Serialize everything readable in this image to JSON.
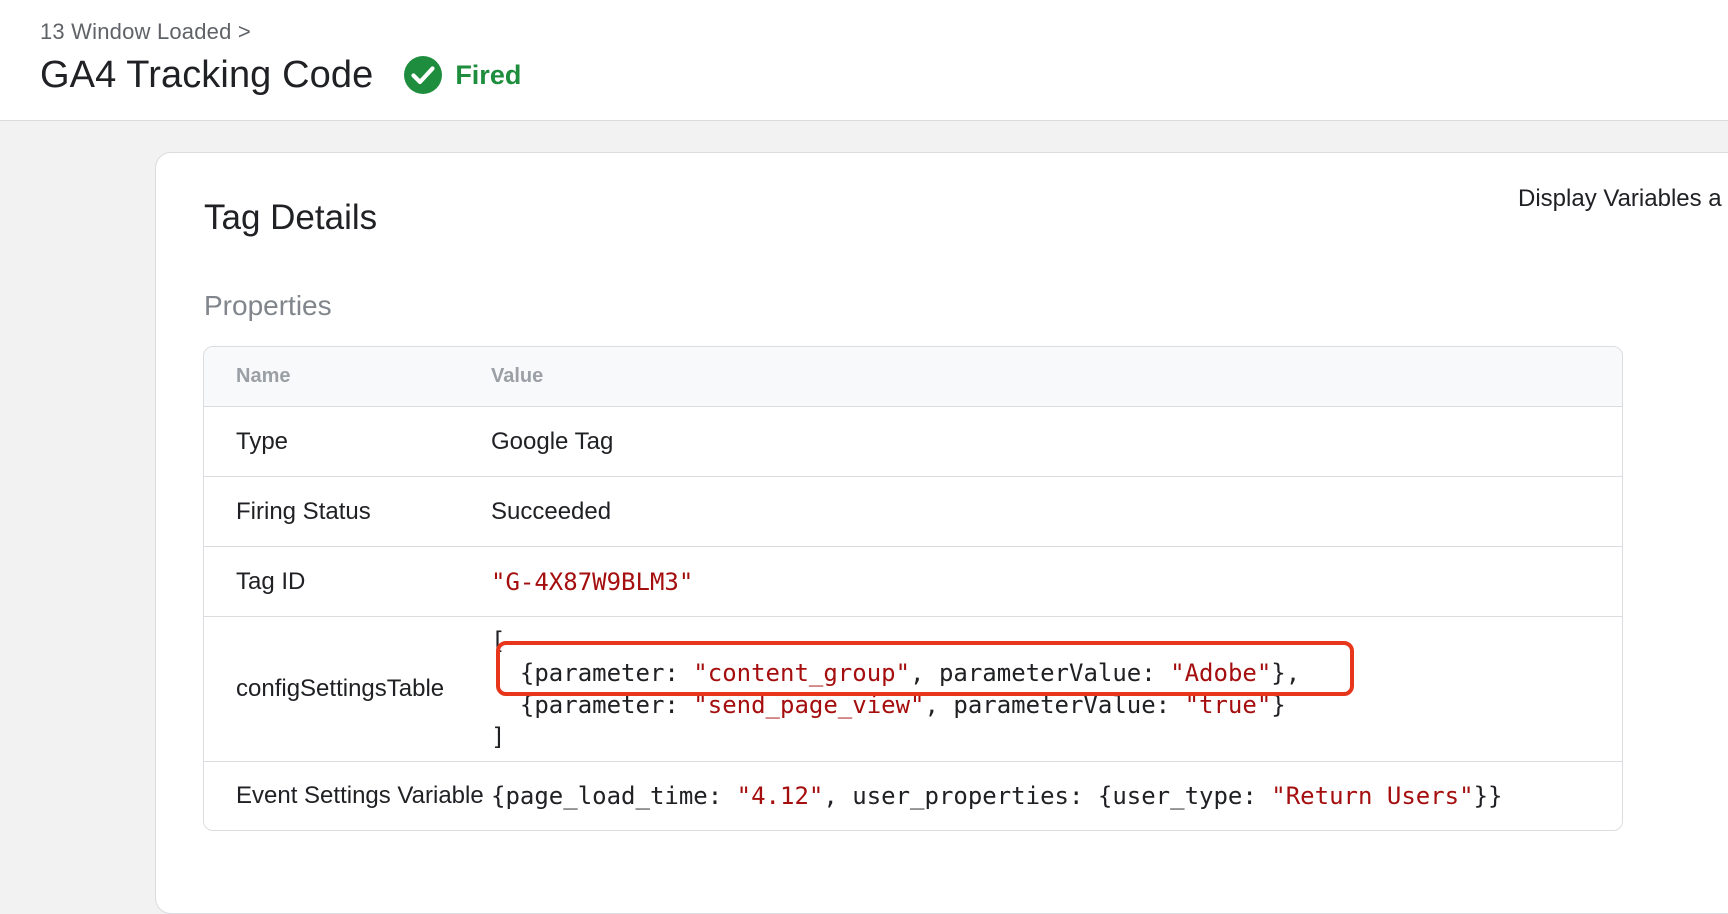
{
  "header": {
    "breadcrumb": "13 Window Loaded >",
    "title": "GA4 Tracking Code",
    "status": "Fired",
    "status_icon": "check-circle-icon",
    "status_color": "#1e8e3e"
  },
  "card": {
    "title": "Tag Details",
    "display_variables_label": "Display Variables a",
    "section_title": "Properties",
    "table": {
      "columns": [
        "Name",
        "Value"
      ],
      "rows": {
        "type": {
          "name": "Type",
          "value": "Google Tag"
        },
        "firing_status": {
          "name": "Firing Status",
          "value": "Succeeded"
        },
        "tag_id": {
          "name": "Tag ID",
          "value": "\"G-4X87W9BLM3\""
        },
        "config": {
          "name": "configSettingsTable",
          "open": "[",
          "line1": {
            "p1": "{parameter: ",
            "s1": "\"content_group\"",
            "p2": ", parameterValue: ",
            "s2": "\"Adobe\"",
            "p3": "},"
          },
          "line2": {
            "p1": "{parameter: ",
            "s1": "\"send_page_view\"",
            "p2": ", parameterValue: ",
            "s2": "\"true\"",
            "p3": "}"
          },
          "close": "]"
        },
        "event_settings": {
          "name": "Event Settings Variable",
          "p1": "{page_load_time: ",
          "s1": "\"4.12\"",
          "p2": ", user_properties: {user_type: ",
          "s2": "\"Return Users\"",
          "p3": "}}"
        }
      }
    },
    "highlight_color": "#e8361c"
  }
}
